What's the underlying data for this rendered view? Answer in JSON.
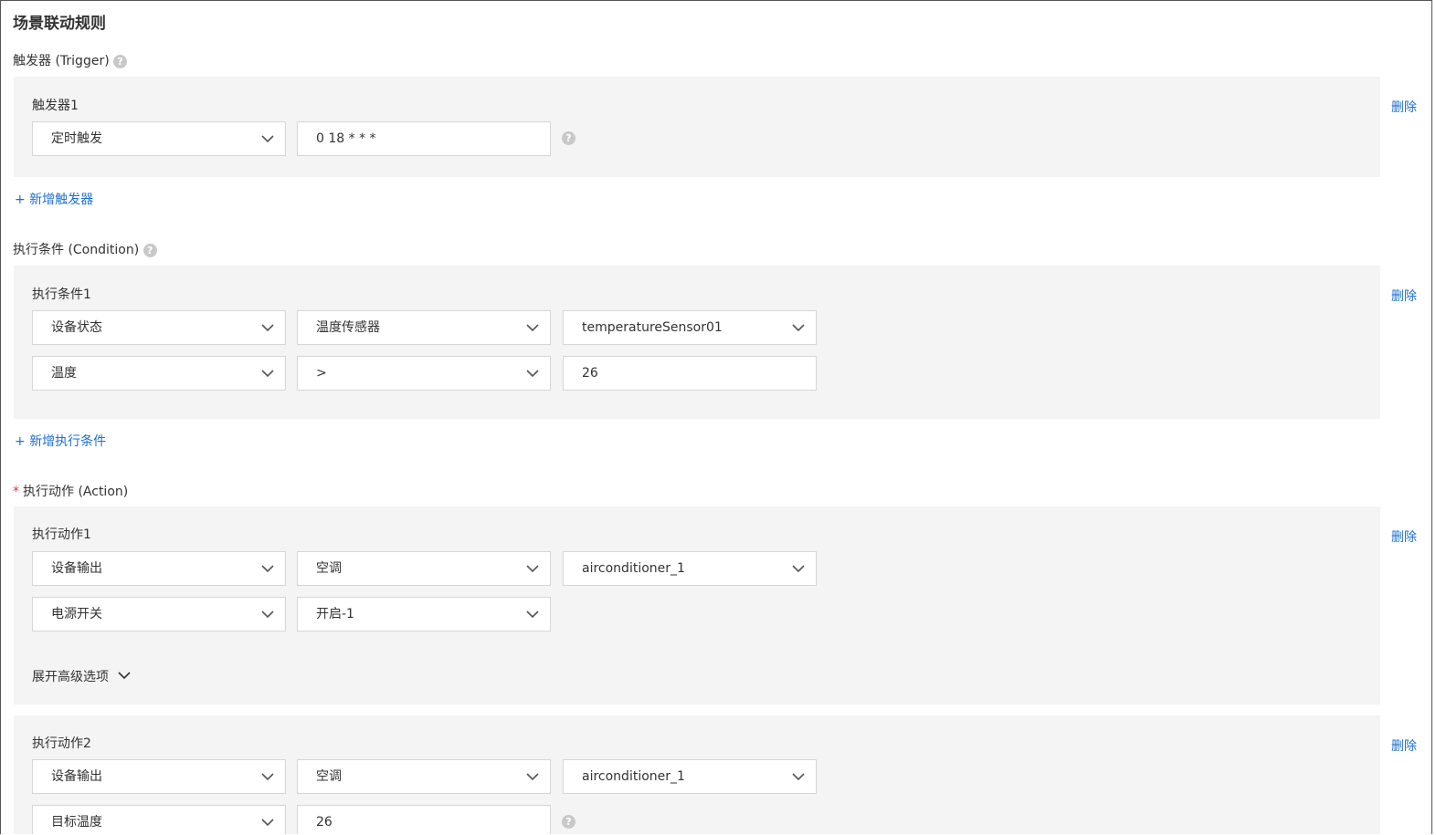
{
  "title": "场景联动规则",
  "trigger": {
    "label": "触发器 (Trigger)",
    "help_glyph": "?",
    "items": [
      {
        "title": "触发器1",
        "type": "定时触发",
        "cron": "0 18 * * *",
        "delete": "删除"
      }
    ],
    "add_link": "+ 新增触发器"
  },
  "condition": {
    "label": "执行条件 (Condition)",
    "help_glyph": "?",
    "items": [
      {
        "title": "执行条件1",
        "type": "设备状态",
        "product": "温度传感器",
        "device": "temperatureSensor01",
        "property": "温度",
        "operator": ">",
        "value": "26",
        "delete": "删除"
      }
    ],
    "add_link": "+ 新增执行条件"
  },
  "action": {
    "required_mark": "*",
    "label": "执行动作 (Action)",
    "items": [
      {
        "title": "执行动作1",
        "type": "设备输出",
        "product": "空调",
        "device": "airconditioner_1",
        "property": "电源开关",
        "value": "开启-1",
        "expand": "展开高级选项",
        "delete": "删除"
      },
      {
        "title": "执行动作2",
        "type": "设备输出",
        "product": "空调",
        "device": "airconditioner_1",
        "property": "目标温度",
        "value": "26",
        "delete": "删除"
      }
    ]
  },
  "colors": {
    "link": "#1e6fd1",
    "panel": "#f4f4f4",
    "required": "#e5322d"
  }
}
